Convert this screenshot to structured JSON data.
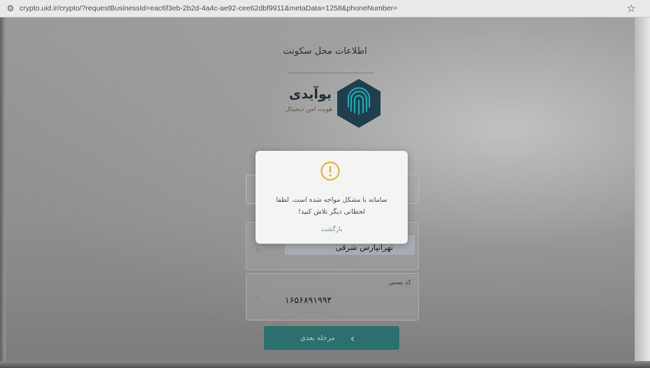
{
  "browser": {
    "url": "crypto.uid.ir/crypto/?requestBusinessId=eac6f3eb-2b2d-4a4c-ae92-cee62dbf9911&metaData=1258&phoneNumber="
  },
  "page": {
    "title": "اطلاعات محل سکونت"
  },
  "logo": {
    "name": "یوآیدی",
    "tagline": "هویت امن دیجیتال",
    "brand_color": "#1f3f4f",
    "accent_color": "#1f8f9a"
  },
  "form": {
    "address_value": "تهرانپارس شرقی",
    "postal_label": "کد پستی",
    "postal_value": "۱۶۵۶۸۹۱۹۹۴",
    "next_button_label": "مرحله بعدی"
  },
  "dialog": {
    "icon": "warning-icon",
    "icon_color": "#e6a93a",
    "message": "سامانه با مشکل مواجه شده است. لطفا لحظاتی دیگر تلاش کنید!",
    "return_label": "بازگشت"
  }
}
